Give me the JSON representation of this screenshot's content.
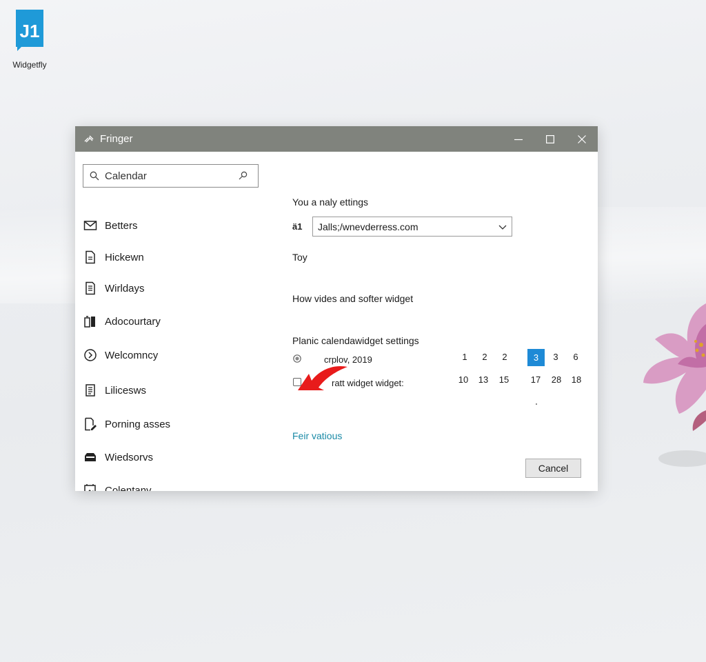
{
  "desktop": {
    "icon_label": "Widgetfly",
    "icon_glyph": "J1"
  },
  "window": {
    "title": "Fringer",
    "controls": {
      "minimize": "minimize-icon",
      "maximize": "maximize-icon",
      "close": "close-icon"
    }
  },
  "sidebar": {
    "search": {
      "value": "Calendar"
    },
    "items": [
      {
        "label": "Betters",
        "icon": "mail-icon"
      },
      {
        "label": "Hickewn",
        "icon": "document-icon"
      },
      {
        "label": "Wirldays",
        "icon": "document-list-icon"
      },
      {
        "label": "Adocourtary",
        "icon": "battery-icon"
      },
      {
        "label": "Welcomncy",
        "icon": "circle-arrow-icon"
      },
      {
        "label": "Lilicesws",
        "icon": "notepad-icon"
      },
      {
        "label": "Porning asses",
        "icon": "edit-document-icon"
      },
      {
        "label": "Wiedsorvs",
        "icon": "toolbox-icon"
      },
      {
        "label": "Colentany",
        "icon": "image-frame-icon"
      }
    ]
  },
  "content": {
    "heading1": "You a naly ettings",
    "url_label": "ä1",
    "url_value": "Jalls;/wnevderress.com",
    "label_top": "Toy",
    "label_videos": "How vides and softer widget",
    "section_calendar": "Planic calendawidget settings",
    "radio_label": "crplov, 2019",
    "checkbox_label": "ratt widget widget:",
    "link": "Feir vatious",
    "calendar": {
      "row1": [
        "1",
        "2",
        "2",
        "3",
        "3",
        "6"
      ],
      "row2": [
        "10",
        "13",
        "15",
        "17",
        "28",
        "18"
      ],
      "selected": "3"
    },
    "cancel_label": "Cancel"
  },
  "colors": {
    "titlebar": "#80837d",
    "accent": "#1e8ad6",
    "link": "#1a8aa6",
    "pointer": "#e81b1b"
  }
}
